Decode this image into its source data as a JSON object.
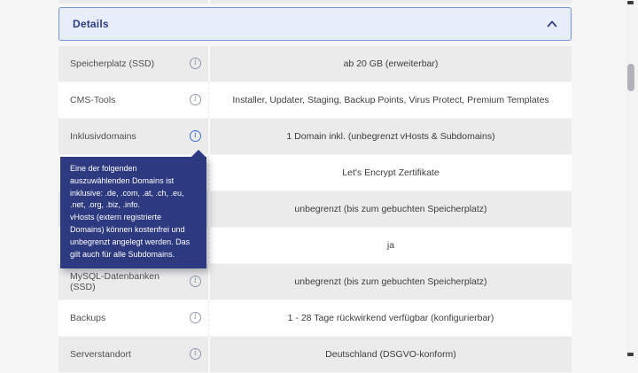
{
  "panel": {
    "title": "Details",
    "state": "expanded",
    "collapse_icon": "chevron-up"
  },
  "info_icon_glyph": "i",
  "table": {
    "rows": [
      {
        "label": "Speicherplatz (SSD)",
        "value": "ab 20 GB (erweiterbar)",
        "shade": "gray",
        "info": true,
        "info_active": false
      },
      {
        "label": "CMS-Tools",
        "value": "Installer, Updater, Staging, Backup Points, Virus Protect, Premium Templates",
        "shade": "white",
        "info": true,
        "info_active": false
      },
      {
        "label": "Inklusivdomains",
        "value": "1 Domain inkl. (unbegrenzt vHosts & Subdomains)",
        "shade": "gray",
        "info": true,
        "info_active": true
      },
      {
        "label": "",
        "value": "Let's Encrypt Zertifikate",
        "shade": "white",
        "info": false,
        "info_active": false
      },
      {
        "label": "",
        "value": "unbegrenzt (bis zum gebuchten Speicherplatz)",
        "shade": "gray",
        "info": false,
        "info_active": false
      },
      {
        "label": "",
        "value": "ja",
        "shade": "white",
        "info": false,
        "info_active": false
      },
      {
        "label": "MySQL-Datenbanken (SSD)",
        "value": "unbegrenzt (bis zum gebuchten Speicherplatz)",
        "shade": "gray",
        "info": true,
        "info_active": false
      },
      {
        "label": "Backups",
        "value": "1 - 28 Tage rückwirkend verfügbar (konfigurierbar)",
        "shade": "white",
        "info": true,
        "info_active": false
      },
      {
        "label": "Serverstandort",
        "value": "Deutschland (DSGVO-konform)",
        "shade": "gray",
        "info": true,
        "info_active": false
      }
    ]
  },
  "tooltip": {
    "attached_to": "Inklusivdomains",
    "paragraphs": [
      "Eine der folgenden auszuwählenden Domains ist inklusive: .de, .com, .at, .ch, .eu, .net, .org, .biz, .info.",
      "vHosts (extern registrierte Domains) können kostenfrei und unbegrenzt angelegt werden. Das gilt auch für alle Subdomains."
    ]
  },
  "colors": {
    "page_background": "#f6f6f7",
    "row_gray": "#ebebec",
    "row_white": "#ffffff",
    "header_background": "#e8eef9",
    "header_border": "#7096d6",
    "header_text": "#2c3c87",
    "tooltip_background": "#2e3a80",
    "tooltip_text": "#ffffff",
    "info_icon_gray": "#9099ab",
    "info_icon_active": "#3d6fd6"
  }
}
